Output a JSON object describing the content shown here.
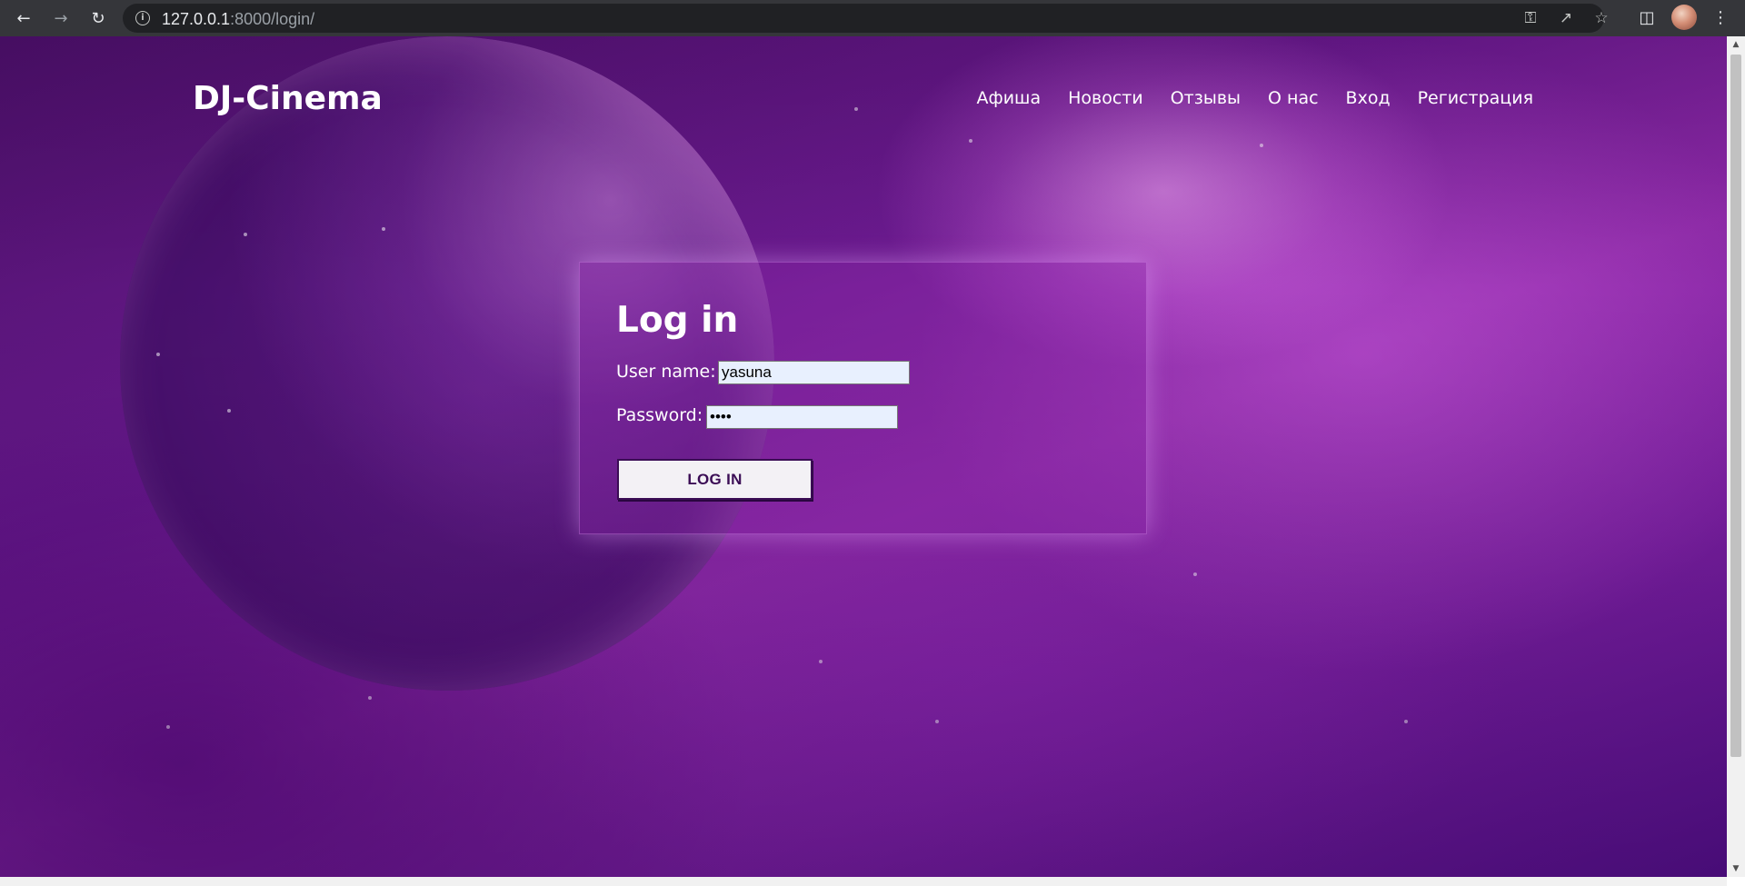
{
  "browser": {
    "url_host": "127.0.0.1",
    "url_rest": ":8000/login/",
    "icons": {
      "back": "back-arrow-icon",
      "forward": "forward-arrow-icon",
      "reload": "reload-icon",
      "site_info": "info-icon",
      "key": "key-icon",
      "share": "share-icon",
      "bookmark": "star-icon",
      "side_panel": "side-panel-icon",
      "menu": "kebab-menu-icon"
    }
  },
  "header": {
    "logo": "DJ-Cinema",
    "nav": [
      "Афиша",
      "Новости",
      "Отзывы",
      "О нас",
      "Вход",
      "Регистрация"
    ]
  },
  "login": {
    "title": "Log in",
    "username_label": "User name:",
    "username_value": "yasuna",
    "password_label": "Password:",
    "password_value": "••••",
    "submit_label": "LOG IN"
  },
  "colors": {
    "chrome_bg": "#35363a",
    "omnibox_bg": "#202124",
    "button_text": "#3b0d55",
    "input_bg": "#e8f0fe"
  }
}
